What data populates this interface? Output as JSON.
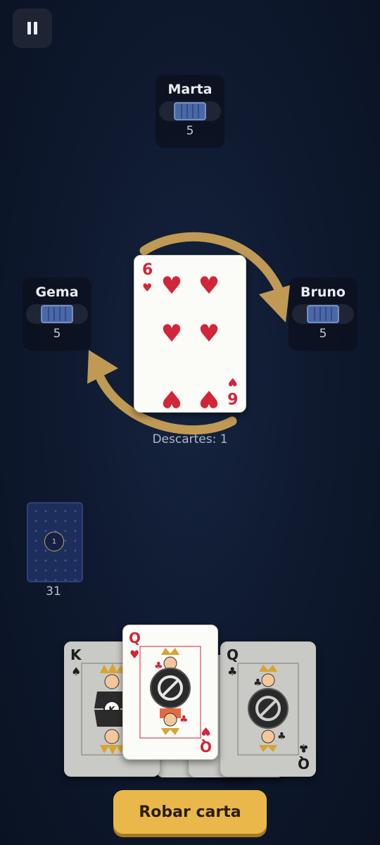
{
  "menu": {
    "pause_icon": "pause-icon"
  },
  "opponents": {
    "top": {
      "name": "Marta",
      "count": "5"
    },
    "left": {
      "name": "Gema",
      "count": "5"
    },
    "right": {
      "name": "Bruno",
      "count": "5"
    }
  },
  "discard": {
    "card": {
      "rank": "6",
      "suit": "hearts",
      "suit_symbol": "♥",
      "color": "#d1263a"
    },
    "label": "Descartes: 1"
  },
  "direction_arrows": {
    "icon": "play-direction-arrows",
    "color": "#c09a54"
  },
  "deck": {
    "badge": "1",
    "count": "31"
  },
  "hand": [
    {
      "rank": "K",
      "suit_symbol": "♠",
      "color": "#1d1d1d",
      "face": "king",
      "center_badge": "K",
      "playable": false
    },
    {
      "rank": "Q",
      "suit_symbol": "♥",
      "color": "#d1263a",
      "face": "queen",
      "center_icon": "block-icon",
      "playable": true
    },
    {
      "rank": "Q",
      "suit_symbol": "♣",
      "color": "#1d1d1d",
      "face": "queen",
      "center_icon": "block-icon",
      "playable": false
    }
  ],
  "actions": {
    "draw_label": "Robar carta"
  }
}
